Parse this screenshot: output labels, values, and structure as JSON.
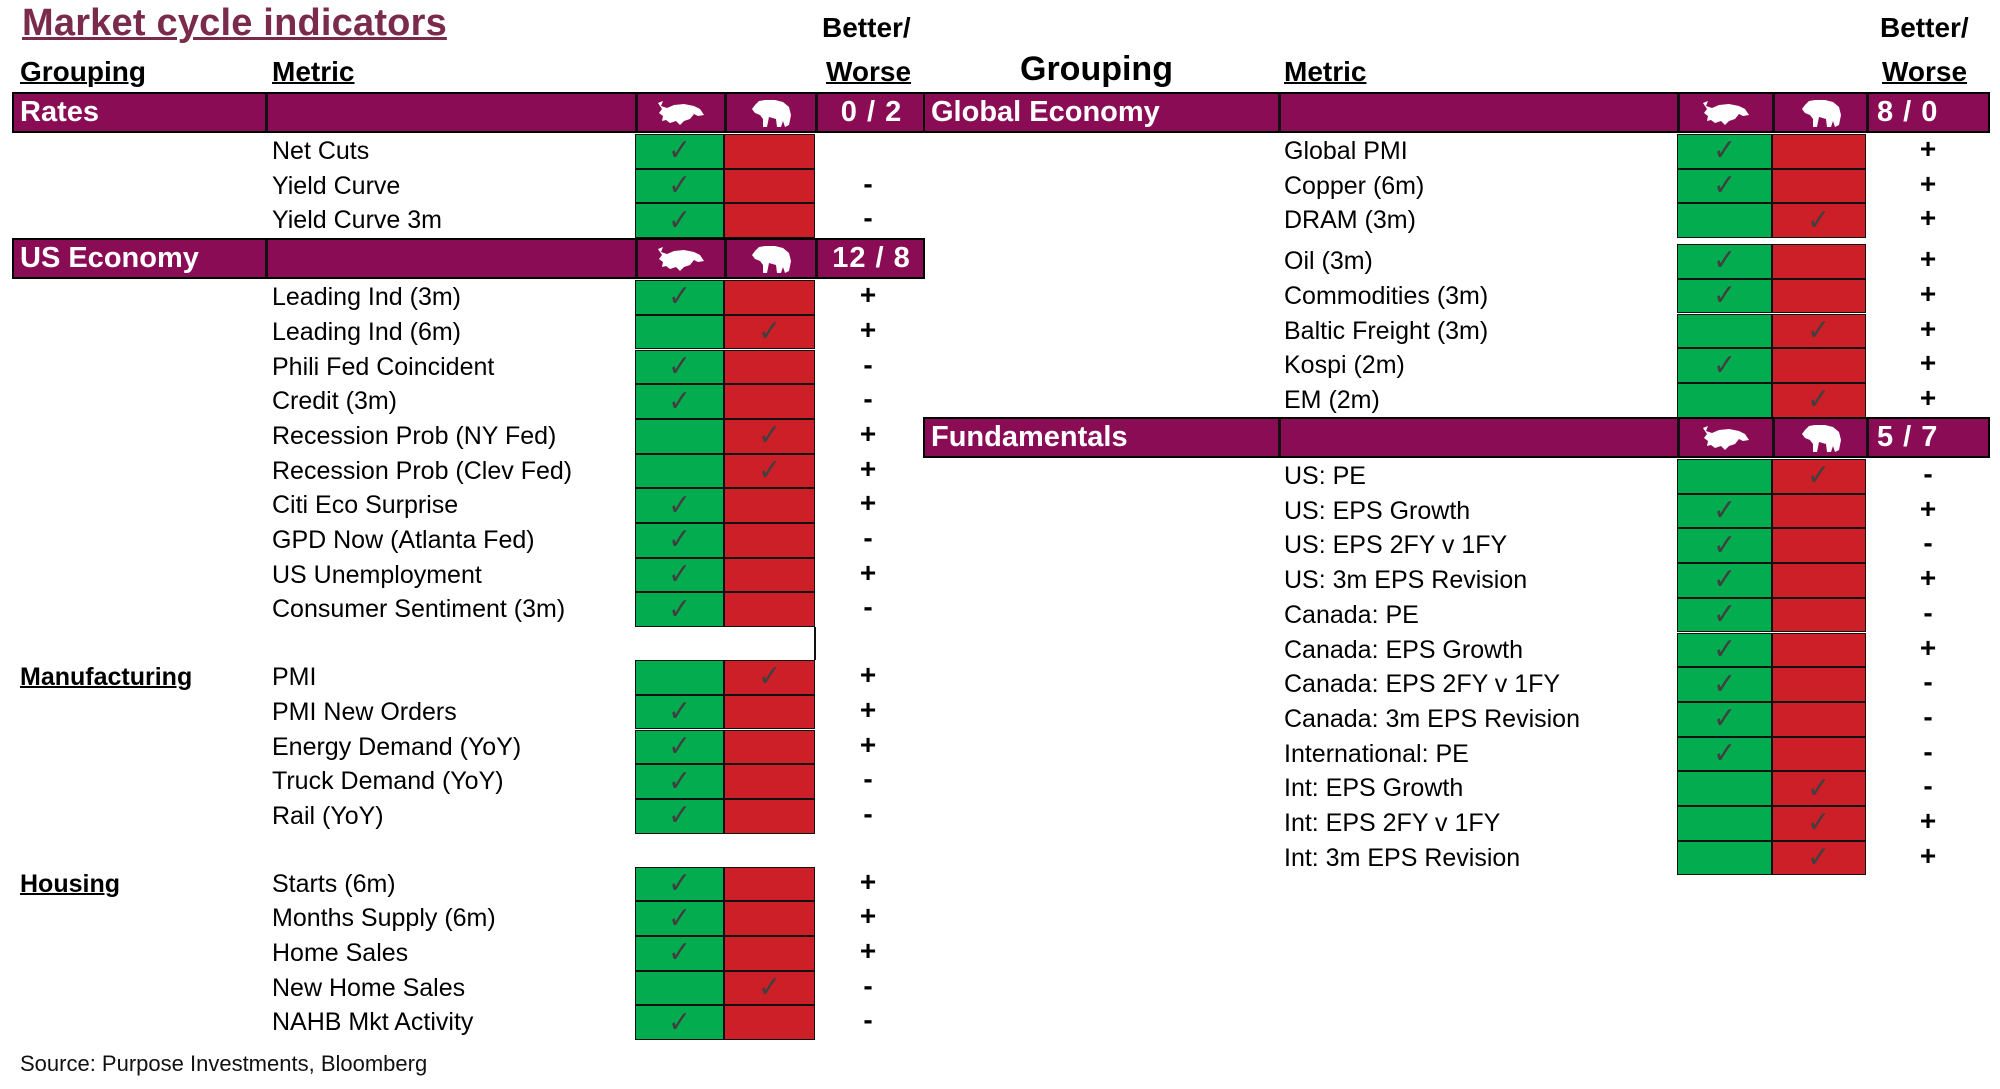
{
  "title": "Market cycle indicators",
  "column_headers": {
    "grouping": "Grouping",
    "metric": "Metric",
    "better_worse_line1": "Better/",
    "better_worse_line2": "Worse"
  },
  "icons": {
    "bull": "bull-icon",
    "bear": "bear-icon",
    "check": "✓"
  },
  "colors": {
    "header_bg": "#8a0c55",
    "title": "#7a2a4a",
    "bull_cell": "#03ad4f",
    "bear_cell": "#cc1f27"
  },
  "left_sections": [
    {
      "name": "Rates",
      "score": "0 / 2",
      "style": "header",
      "rows": [
        {
          "metric": "Net Cuts",
          "signal": "bull",
          "change": ""
        },
        {
          "metric": "Yield Curve",
          "signal": "bull",
          "change": "-"
        },
        {
          "metric": "Yield Curve 3m",
          "signal": "bull",
          "change": "-"
        }
      ]
    },
    {
      "name": "US Economy",
      "score": "12 / 8",
      "style": "header",
      "rows": [
        {
          "metric": "Leading Ind (3m)",
          "signal": "bull",
          "change": "+"
        },
        {
          "metric": "Leading Ind (6m)",
          "signal": "bear",
          "change": "+"
        },
        {
          "metric": "Phili Fed Coincident",
          "signal": "bull",
          "change": "-"
        },
        {
          "metric": "Credit (3m)",
          "signal": "bull",
          "change": "-"
        },
        {
          "metric": "Recession Prob (NY Fed)",
          "signal": "bear",
          "change": "+"
        },
        {
          "metric": "Recession Prob (Clev Fed)",
          "signal": "bear",
          "change": "+"
        },
        {
          "metric": "Citi Eco Surprise",
          "signal": "bull",
          "change": "+"
        },
        {
          "metric": "GPD Now (Atlanta Fed)",
          "signal": "bull",
          "change": "-"
        },
        {
          "metric": "US Unemployment",
          "signal": "bull",
          "change": "+"
        },
        {
          "metric": "Consumer Sentiment (3m)",
          "signal": "bull",
          "change": "-"
        }
      ]
    },
    {
      "name": "Manufacturing",
      "style": "subgroup",
      "rows": [
        {
          "metric": "PMI",
          "signal": "bear",
          "change": "+"
        },
        {
          "metric": "PMI New Orders",
          "signal": "bull",
          "change": "+"
        },
        {
          "metric": "Energy Demand (YoY)",
          "signal": "bull",
          "change": "+"
        },
        {
          "metric": "Truck Demand (YoY)",
          "signal": "bull",
          "change": "-"
        },
        {
          "metric": "Rail (YoY)",
          "signal": "bull",
          "change": "-"
        }
      ]
    },
    {
      "name": "Housing",
      "style": "subgroup",
      "rows": [
        {
          "metric": "Starts (6m)",
          "signal": "bull",
          "change": "+"
        },
        {
          "metric": "Months Supply (6m)",
          "signal": "bull",
          "change": "+"
        },
        {
          "metric": "Home Sales",
          "signal": "bull",
          "change": "+"
        },
        {
          "metric": "New Home Sales",
          "signal": "bear",
          "change": "-"
        },
        {
          "metric": "NAHB Mkt Activity",
          "signal": "bull",
          "change": "-"
        }
      ]
    }
  ],
  "right_sections": [
    {
      "name": "Global Economy",
      "score": "8 / 0",
      "rows": [
        {
          "metric": "Global PMI",
          "signal": "bull",
          "change": "+"
        },
        {
          "metric": "Copper (6m)",
          "signal": "bull",
          "change": "+"
        },
        {
          "metric": "DRAM (3m)",
          "signal": "bear",
          "change": "+"
        },
        {
          "metric": "Oil (3m)",
          "signal": "bull",
          "change": "+"
        },
        {
          "metric": "Commodities (3m)",
          "signal": "bull",
          "change": "+"
        },
        {
          "metric": "Baltic Freight (3m)",
          "signal": "bear",
          "change": "+"
        },
        {
          "metric": "Kospi (2m)",
          "signal": "bull",
          "change": "+"
        },
        {
          "metric": "EM (2m)",
          "signal": "bear",
          "change": "+"
        }
      ]
    },
    {
      "name": "Fundamentals",
      "score": "5 / 7",
      "rows": [
        {
          "metric": "US: PE",
          "signal": "bear",
          "change": "-"
        },
        {
          "metric": "US: EPS Growth",
          "signal": "bull",
          "change": "+"
        },
        {
          "metric": "US: EPS 2FY v 1FY",
          "signal": "bull",
          "change": "-"
        },
        {
          "metric": "US: 3m EPS Revision",
          "signal": "bull",
          "change": "+"
        },
        {
          "metric": "Canada: PE",
          "signal": "bull",
          "change": "-"
        },
        {
          "metric": "Canada: EPS Growth",
          "signal": "bull",
          "change": "+"
        },
        {
          "metric": "Canada: EPS 2FY v 1FY",
          "signal": "bull",
          "change": "-"
        },
        {
          "metric": "Canada: 3m EPS Revision",
          "signal": "bull",
          "change": "-"
        },
        {
          "metric": "International: PE",
          "signal": "bull",
          "change": "-"
        },
        {
          "metric": "Int: EPS Growth",
          "signal": "bear",
          "change": "-"
        },
        {
          "metric": "Int: EPS 2FY v 1FY",
          "signal": "bear",
          "change": "+"
        },
        {
          "metric": "Int: 3m EPS Revision",
          "signal": "bear",
          "change": "+"
        }
      ]
    }
  ],
  "source": "Source: Purpose Investments, Bloomberg"
}
